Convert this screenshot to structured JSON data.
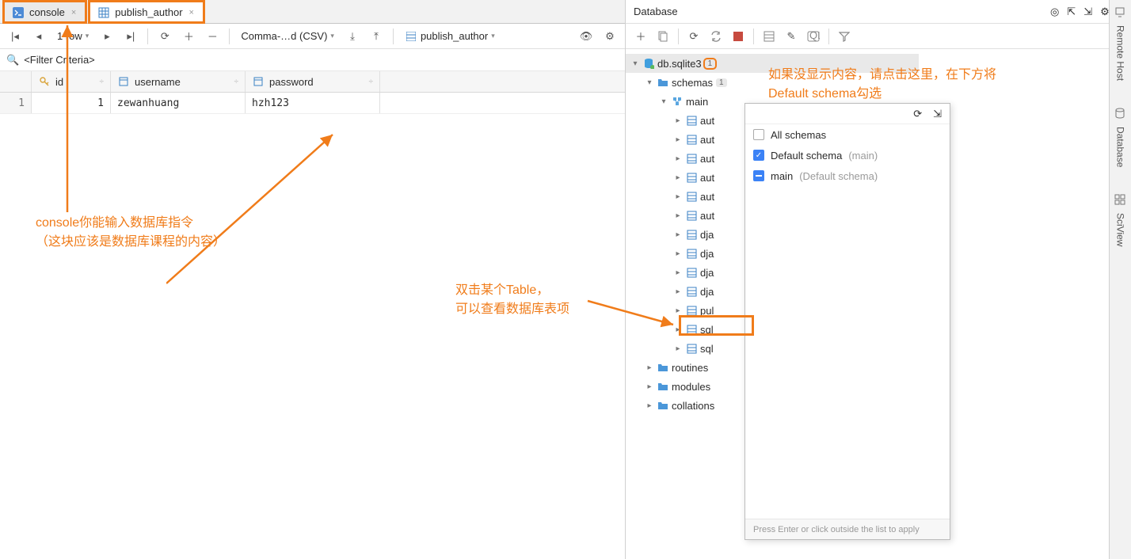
{
  "tabs": [
    {
      "label": "console"
    },
    {
      "label": "publish_author"
    }
  ],
  "toolbar": {
    "rows": "1 row",
    "format": "Comma-…d (CSV)",
    "table": "publish_author"
  },
  "filter_placeholder": "<Filter Criteria>",
  "grid": {
    "cols": [
      "id",
      "username",
      "password"
    ],
    "rows": [
      [
        "1",
        "zewanhuang",
        "hzh123"
      ]
    ]
  },
  "db_panel": {
    "title": "Database"
  },
  "tree": {
    "db": "db.sqlite3",
    "db_badge": "1",
    "schemas": "schemas",
    "schemas_badge": "1",
    "main": "main",
    "tables": [
      "aut",
      "aut",
      "aut",
      "aut",
      "aut",
      "aut",
      "dja",
      "dja",
      "dja",
      "dja",
      "pul",
      "sql",
      "sql"
    ],
    "other": [
      "routines",
      "modules",
      "collations"
    ]
  },
  "popup": {
    "toolbar_hint": "",
    "all": "All schemas",
    "def": "Default schema",
    "def_sfx": "(main)",
    "main": "main",
    "main_sfx": "(Default schema)",
    "foot": "Press Enter or click outside the list to apply"
  },
  "annotations": {
    "a1": "如果没显示内容，请点击这里，在下方将\nDefault schema勾选",
    "a2": "双击某个Table，\n可以查看数据库表项",
    "a3": "console你能输入数据库指令\n（这块应该是数据库课程的内容）"
  },
  "side": {
    "remote": "Remote Host",
    "database": "Database",
    "sciview": "SciView"
  }
}
